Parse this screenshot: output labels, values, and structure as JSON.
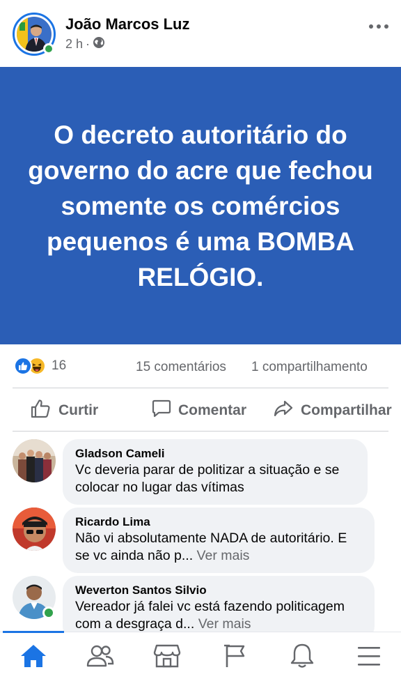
{
  "post": {
    "author": "João Marcos Luz",
    "time": "2 h",
    "separator": "·",
    "privacy_icon": "globe-icon",
    "text": "O decreto autoritário do governo do acre que fechou somente os comércios pequenos é uma BOMBA RELÓGIO.",
    "background_color": "#2b5eb6"
  },
  "stats": {
    "reaction_icons": [
      "like-icon",
      "haha-icon"
    ],
    "reaction_count": "16",
    "comments": "15 comentários",
    "shares": "1 compartilhamento"
  },
  "actions": {
    "like": "Curtir",
    "comment": "Comentar",
    "share": "Compartilhar"
  },
  "comments": [
    {
      "name": "Gladson Cameli",
      "text": "Vc deveria parar de politizar a situação e se colocar no lugar das vítimas",
      "see_more": ""
    },
    {
      "name": "Ricardo Lima",
      "text": "Não vi absolutamente NADA de autoritário. E se vc ainda não p...",
      "see_more": "Ver mais"
    },
    {
      "name": "Weverton Santos Silvio",
      "text": "Vereador já falei vc está fazendo politicagem  com a desgraça d...",
      "see_more": "Ver mais"
    }
  ],
  "bottom_nav": {
    "items": [
      "home-icon",
      "friends-icon",
      "marketplace-icon",
      "pages-icon",
      "notifications-icon",
      "menu-icon"
    ],
    "active": "home-icon"
  },
  "colors": {
    "accent": "#1b74e4",
    "online": "#31a24c",
    "secondary_text": "#65676b",
    "bubble": "#f0f2f5"
  }
}
